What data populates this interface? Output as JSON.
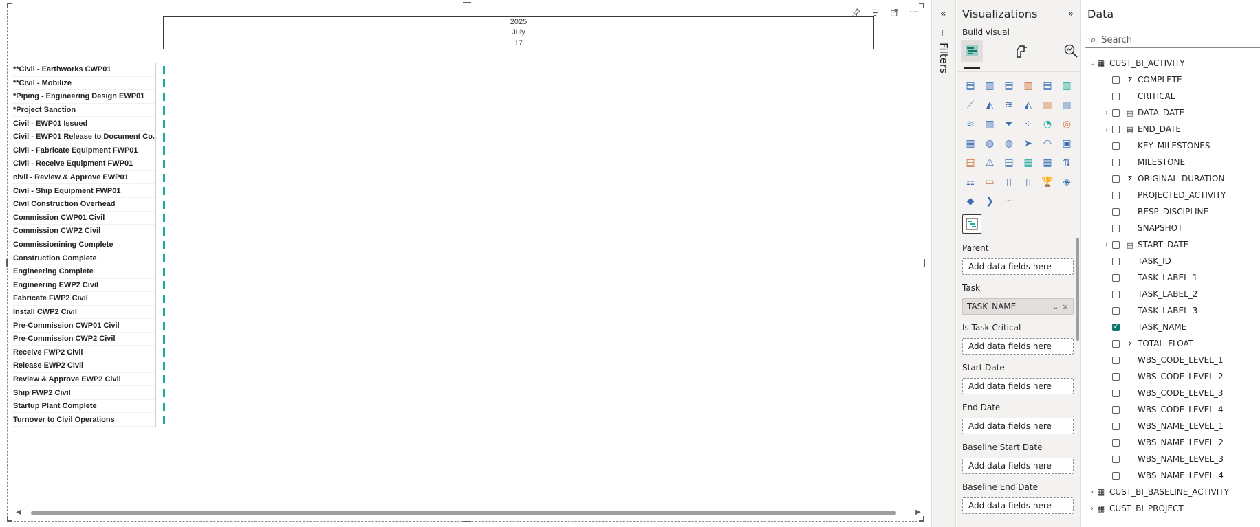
{
  "gantt": {
    "timeline": {
      "year": "2025",
      "month": "July",
      "day": "17"
    },
    "tasks": [
      "**Civil - Earthworks CWP01",
      "**Civil - Mobilize",
      "*Piping - Engineering Design EWP01",
      "*Project Sanction",
      "Civil - EWP01 Issued",
      "Civil - EWP01 Release to Document Co...",
      "Civil - Fabricate Equipment FWP01",
      "Civil - Receive Equipment FWP01",
      "civil - Review & Approve EWP01",
      "Civil - Ship Equipment FWP01",
      "Civil Construction Overhead",
      "Commission CWP01 Civil",
      "Commission CWP2 Civil",
      "Commissionining Complete",
      "Construction Complete",
      "Engineering Complete",
      "Engineering EWP2 Civil",
      "Fabricate FWP2 Civil",
      "Install CWP2 Civil",
      "Pre-Commission CWP01 Civil",
      "Pre-Commission CWP2 Civil",
      "Receive FWP2 Civil",
      "Release EWP2 Civil",
      "Review & Approve EWP2 Civil",
      "Ship FWP2 Civil",
      "Startup Plant Complete",
      "Turnover to Civil Operations"
    ],
    "bar_color": "#1aab9b"
  },
  "filters": {
    "label": "Filters"
  },
  "visualizations": {
    "title": "Visualizations",
    "build_visual": "Build visual",
    "wells": {
      "parent": {
        "label": "Parent",
        "placeholder": "Add data fields here"
      },
      "task": {
        "label": "Task",
        "field": "TASK_NAME"
      },
      "critical": {
        "label": "Is Task Critical",
        "placeholder": "Add data fields here"
      },
      "start": {
        "label": "Start Date",
        "placeholder": "Add data fields here"
      },
      "end": {
        "label": "End Date",
        "placeholder": "Add data fields here"
      },
      "bstart": {
        "label": "Baseline Start Date",
        "placeholder": "Add data fields here"
      },
      "bend": {
        "label": "Baseline End Date",
        "placeholder": "Add data fields here"
      }
    },
    "gallery_icons": [
      "stacked-bar-chart-icon",
      "stacked-column-chart-icon",
      "clustered-bar-chart-icon",
      "clustered-column-chart-icon",
      "100-stacked-bar-chart-icon",
      "100-stacked-column-chart-icon",
      "line-chart-icon",
      "area-chart-icon",
      "stacked-area-chart-icon",
      "100-stacked-area-chart-icon",
      "line-stacked-column-chart-icon",
      "line-clustered-column-chart-icon",
      "ribbon-chart-icon",
      "waterfall-chart-icon",
      "funnel-chart-icon",
      "scatter-chart-icon",
      "pie-chart-icon",
      "donut-chart-icon",
      "treemap-icon",
      "map-icon",
      "filled-map-icon",
      "azure-map-icon",
      "gauge-icon",
      "card-icon",
      "multi-row-card-icon",
      "kpi-icon",
      "slicer-icon",
      "table-icon",
      "matrix-icon",
      "key-influencers-icon",
      "decomposition-tree-icon",
      "qa-icon",
      "paginated-report-icon",
      "smart-narrative-icon",
      "metrics-icon",
      "power-apps-icon",
      "power-automate-icon",
      "shape-map-icon",
      "more-visuals-icon"
    ]
  },
  "data": {
    "title": "Data",
    "search_placeholder": "Search",
    "tables": [
      {
        "name": "CUST_BI_ACTIVITY",
        "expanded": true,
        "fields": [
          {
            "name": "COMPLETE",
            "type": "sigma",
            "checked": false,
            "expandable": false
          },
          {
            "name": "CRITICAL",
            "type": "",
            "checked": false,
            "expandable": false
          },
          {
            "name": "DATA_DATE",
            "type": "calendar",
            "checked": false,
            "expandable": true
          },
          {
            "name": "END_DATE",
            "type": "calendar",
            "checked": false,
            "expandable": true
          },
          {
            "name": "KEY_MILESTONES",
            "type": "",
            "checked": false,
            "expandable": false
          },
          {
            "name": "MILESTONE",
            "type": "",
            "checked": false,
            "expandable": false
          },
          {
            "name": "ORIGINAL_DURATION",
            "type": "sigma",
            "checked": false,
            "expandable": false
          },
          {
            "name": "PROJECTED_ACTIVITY",
            "type": "",
            "checked": false,
            "expandable": false
          },
          {
            "name": "RESP_DISCIPLINE",
            "type": "",
            "checked": false,
            "expandable": false
          },
          {
            "name": "SNAPSHOT",
            "type": "",
            "checked": false,
            "expandable": false
          },
          {
            "name": "START_DATE",
            "type": "calendar",
            "checked": false,
            "expandable": true
          },
          {
            "name": "TASK_ID",
            "type": "",
            "checked": false,
            "expandable": false
          },
          {
            "name": "TASK_LABEL_1",
            "type": "",
            "checked": false,
            "expandable": false
          },
          {
            "name": "TASK_LABEL_2",
            "type": "",
            "checked": false,
            "expandable": false
          },
          {
            "name": "TASK_LABEL_3",
            "type": "",
            "checked": false,
            "expandable": false
          },
          {
            "name": "TASK_NAME",
            "type": "",
            "checked": true,
            "expandable": false
          },
          {
            "name": "TOTAL_FLOAT",
            "type": "sigma",
            "checked": false,
            "expandable": false
          },
          {
            "name": "WBS_CODE_LEVEL_1",
            "type": "",
            "checked": false,
            "expandable": false
          },
          {
            "name": "WBS_CODE_LEVEL_2",
            "type": "",
            "checked": false,
            "expandable": false
          },
          {
            "name": "WBS_CODE_LEVEL_3",
            "type": "",
            "checked": false,
            "expandable": false
          },
          {
            "name": "WBS_CODE_LEVEL_4",
            "type": "",
            "checked": false,
            "expandable": false
          },
          {
            "name": "WBS_NAME_LEVEL_1",
            "type": "",
            "checked": false,
            "expandable": false
          },
          {
            "name": "WBS_NAME_LEVEL_2",
            "type": "",
            "checked": false,
            "expandable": false
          },
          {
            "name": "WBS_NAME_LEVEL_3",
            "type": "",
            "checked": false,
            "expandable": false
          },
          {
            "name": "WBS_NAME_LEVEL_4",
            "type": "",
            "checked": false,
            "expandable": false
          }
        ]
      },
      {
        "name": "CUST_BI_BASELINE_ACTIVITY",
        "expanded": false,
        "fields": []
      },
      {
        "name": "CUST_BI_PROJECT",
        "expanded": false,
        "fields": []
      }
    ]
  }
}
